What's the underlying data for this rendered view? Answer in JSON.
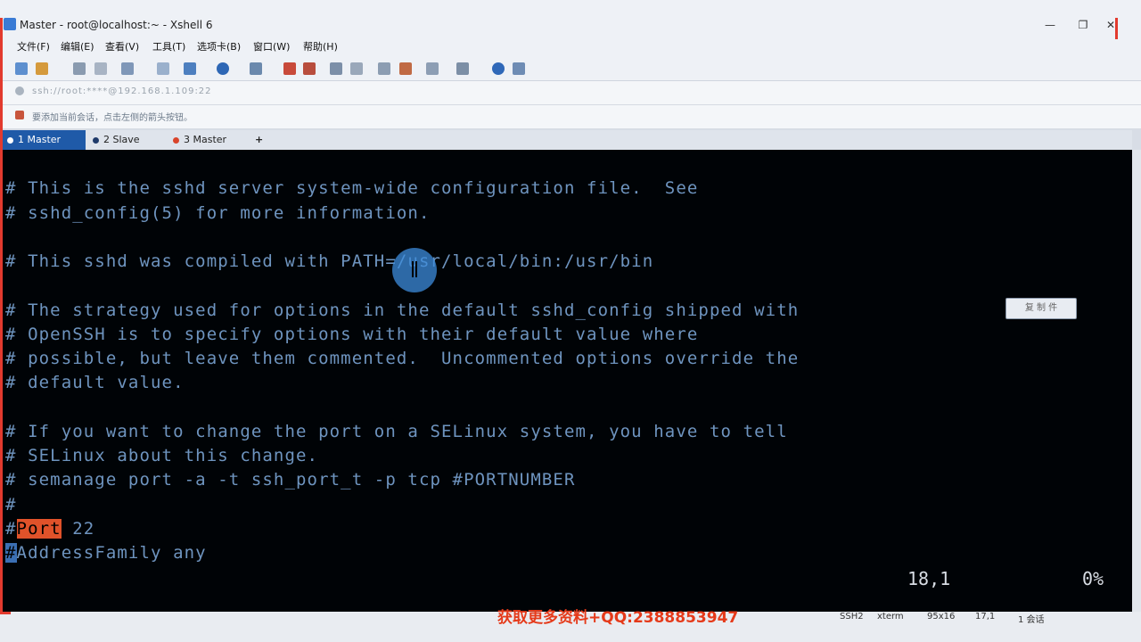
{
  "window": {
    "title": "Master - root@localhost:~ - Xshell 6",
    "minimize": "—",
    "maximize": "❐",
    "close": "✕"
  },
  "menu": [
    "文件(F)",
    "编辑(E)",
    "查看(V)",
    "工具(T)",
    "选项卡(B)",
    "窗口(W)",
    "帮助(H)"
  ],
  "address_bar": {
    "value": "ssh://root:****@192.168.1.109:22"
  },
  "hint_bar": {
    "text": "要添加当前会话，点击左侧的箭头按钮。"
  },
  "tabs": [
    {
      "label": "1 Master",
      "active": true,
      "dot_color": "#ffffff"
    },
    {
      "label": "2 Slave",
      "active": false,
      "dot_color": "#1f3a6a"
    },
    {
      "label": "3 Master",
      "active": false,
      "dot_color": "#d9442b"
    }
  ],
  "add_tab": "+",
  "terminal": {
    "lines": [
      {
        "text": "# This is the sshd server system-wide configuration file.  See"
      },
      {
        "text": "# sshd_config(5) for more information."
      },
      {
        "text": ""
      },
      {
        "text": "# This sshd was compiled with PATH=/usr/local/bin:/usr/bin"
      },
      {
        "text": ""
      },
      {
        "text": "# The strategy used for options in the default sshd_config shipped with"
      },
      {
        "text": "# OpenSSH is to specify options with their default value where"
      },
      {
        "text": "# possible, but leave them commented.  Uncommented options override the"
      },
      {
        "text": "# default value."
      },
      {
        "text": ""
      },
      {
        "text": "# If you want to change the port on a SELinux system, you have to tell"
      },
      {
        "text": "# SELinux about this change."
      },
      {
        "text": "# semanage port -a -t ssh_port_t -p tcp #PORTNUMBER"
      },
      {
        "text": "#"
      }
    ],
    "port_line": {
      "prefix": "#",
      "keyword": "Port",
      "rest": " 22"
    },
    "addr_line": {
      "prefix": "#",
      "rest": "AddressFamily any"
    },
    "cursor_pos": "18,1",
    "scroll_pct": "0%"
  },
  "overlay": "复 制 件",
  "bottom_bar": {
    "protocol": "SSH2",
    "term": "xterm",
    "size": "95x16",
    "pos": "17,1",
    "sessions": "1 会话"
  },
  "watermark": "获取更多资料+QQ:2388853947",
  "colors": {
    "terminal_text": "#6e94bf",
    "highlight": "#e0522a",
    "tab_active": "#1f5aa8"
  }
}
